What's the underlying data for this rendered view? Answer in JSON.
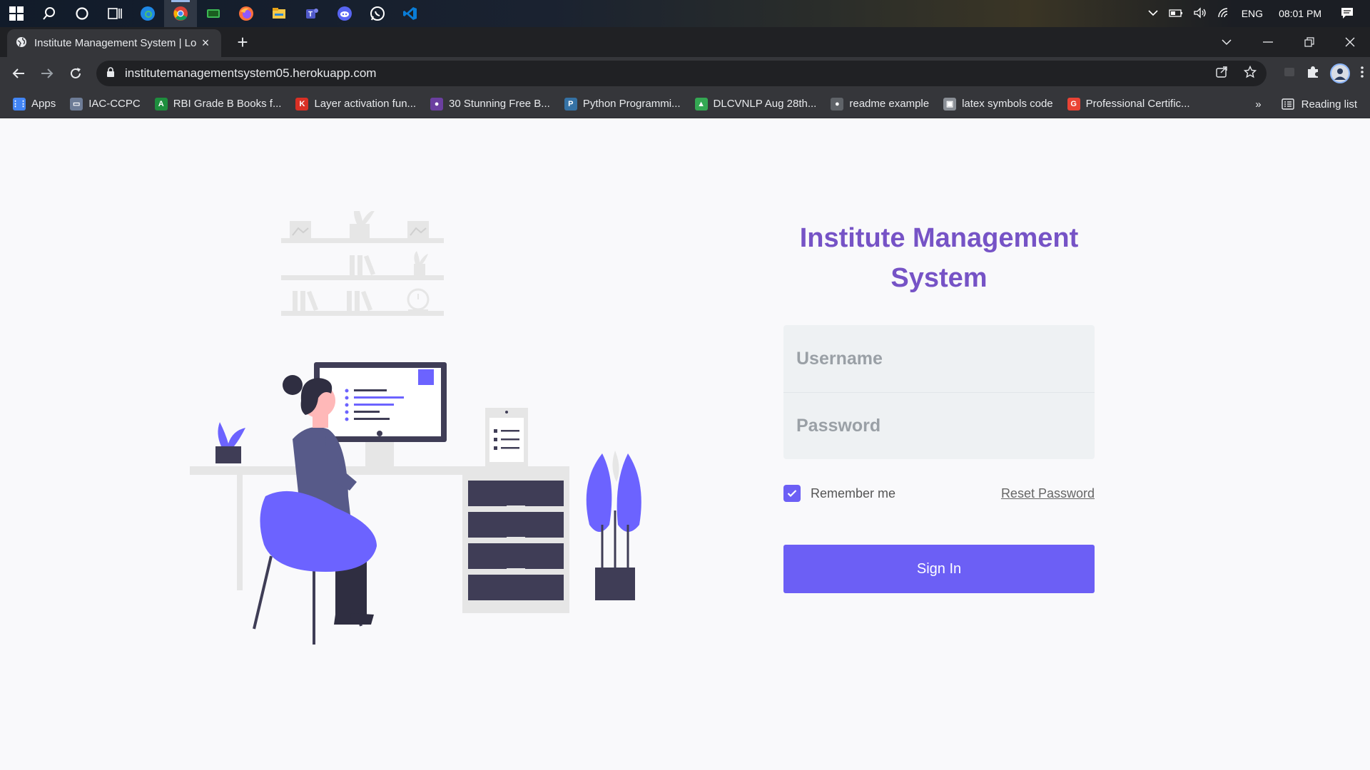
{
  "taskbar": {
    "apps": [
      "windows-start",
      "search",
      "cortana",
      "task-view",
      "edge",
      "chrome",
      "terminal",
      "firefox",
      "file-explorer",
      "teams",
      "discord",
      "whatsapp",
      "vscode"
    ],
    "tray": {
      "language": "ENG",
      "time": "08:01 PM"
    }
  },
  "browser": {
    "tab_title": "Institute Management System | Lo",
    "url": "institutemanagementsystem05.herokuapp.com",
    "bookmarks": [
      {
        "label": "Apps",
        "color": "#4285f4",
        "glyph": "⋮⋮"
      },
      {
        "label": "IAC-CCPC",
        "color": "#6d7c96",
        "glyph": "▭"
      },
      {
        "label": "RBI Grade B Books f...",
        "color": "#1e8e3e",
        "glyph": "A"
      },
      {
        "label": "Layer activation fun...",
        "color": "#d93025",
        "glyph": "K"
      },
      {
        "label": "30 Stunning Free B...",
        "color": "#6b3fa0",
        "glyph": "●"
      },
      {
        "label": "Python Programmi...",
        "color": "#3572a5",
        "glyph": "P"
      },
      {
        "label": "DLCVNLP Aug 28th...",
        "color": "#34a853",
        "glyph": "▲"
      },
      {
        "label": "readme example",
        "color": "#5f6368",
        "glyph": "●"
      },
      {
        "label": "latex symbols code",
        "color": "#8a8f96",
        "glyph": "▣"
      },
      {
        "label": "Professional Certific...",
        "color": "#ea4335",
        "glyph": "G"
      }
    ],
    "bookmarks_more": "»",
    "reading_list": "Reading list"
  },
  "login": {
    "title": "Institute Management System",
    "username_placeholder": "Username",
    "password_placeholder": "Password",
    "remember_label": "Remember me",
    "remember_checked": true,
    "reset_label": "Reset Password",
    "signin_label": "Sign In"
  },
  "colors": {
    "accent": "#6c5ff5",
    "title": "#7653c6",
    "illustration_dark": "#3f3d56",
    "illustration_light": "#e6e6e6"
  }
}
